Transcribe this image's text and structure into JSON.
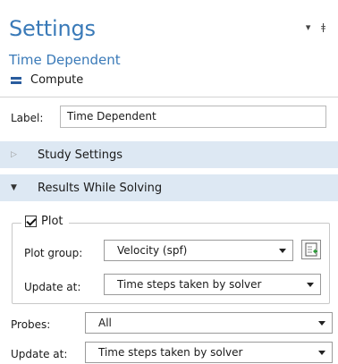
{
  "header": {
    "title": "Settings",
    "subtitle": "Time Dependent",
    "compute_label": "Compute",
    "window_controls": [
      "▾",
      "ǂ"
    ]
  },
  "label_row": {
    "label": "Label:",
    "value": "Time Dependent"
  },
  "sections": [
    {
      "title": "Study Settings",
      "expanded": false
    },
    {
      "title": "Results While Solving",
      "expanded": true
    }
  ],
  "plot": {
    "checkbox_label": "Plot",
    "checked": true,
    "plot_group_label": "Plot group:",
    "plot_group_value": "Velocity (spf)",
    "update_at_label": "Update at:",
    "update_at_value": "Time steps taken by solver"
  },
  "probes": {
    "label": "Probes:",
    "value": "All",
    "update_at_label": "Update at:",
    "update_at_value": "Time steps taken by solver"
  },
  "colors": {
    "accent": "#3a7ab8",
    "section_bg": "#dde8f3",
    "compute_icon": "#2a5d9e"
  }
}
